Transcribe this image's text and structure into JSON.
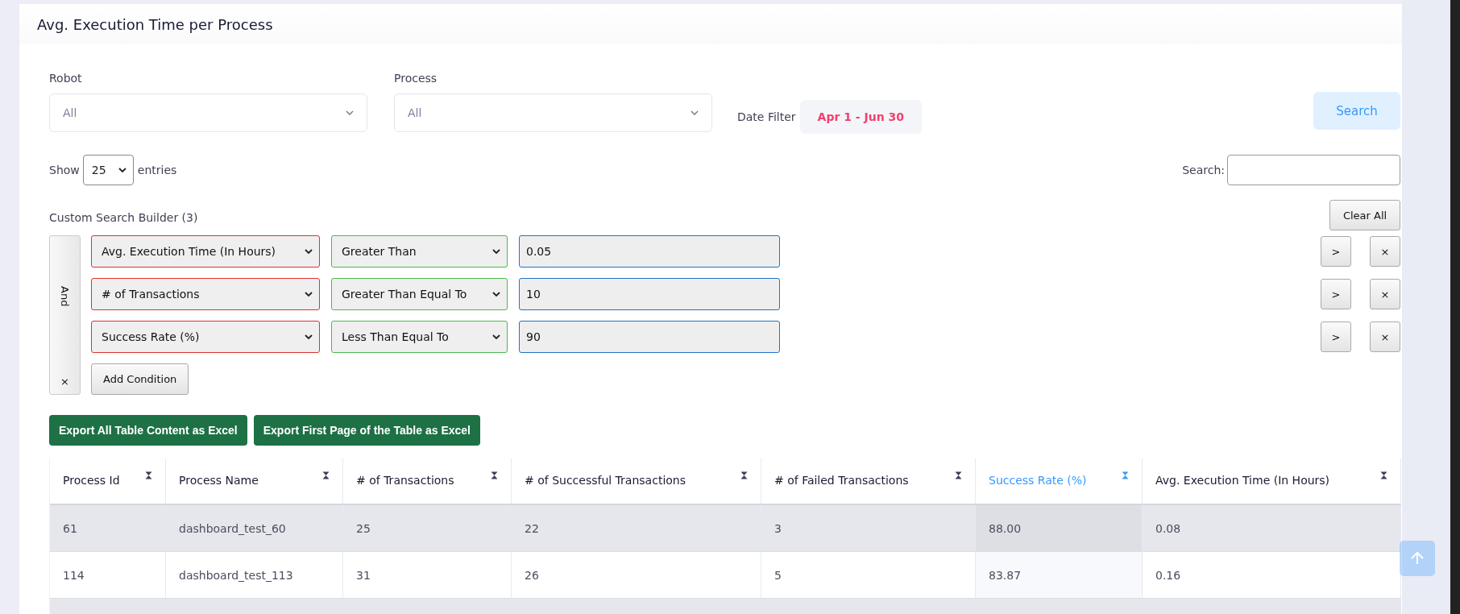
{
  "title": "Avg. Execution Time per Process",
  "filters": [
    {
      "label": "Robot",
      "value": "All"
    },
    {
      "label": "Process",
      "value": "All"
    }
  ],
  "date_filter": {
    "label": "Date Filter",
    "value": "Apr 1 - Jun 30"
  },
  "search_button": "Search",
  "length": {
    "prefix": "Show",
    "value": "25",
    "suffix": "entries"
  },
  "search": {
    "label": "Search:"
  },
  "builder": {
    "title": "Custom Search Builder (3)",
    "clear_all": "Clear All",
    "logic": "And",
    "logic_remove": "×",
    "add_condition": "Add Condition",
    "conditions": [
      {
        "field": "Avg. Execution Time (In Hours)",
        "operator": "Greater Than",
        "value": "0.05",
        "indent": ">",
        "remove": "×"
      },
      {
        "field": "# of Transactions",
        "operator": "Greater Than Equal To",
        "value": "10",
        "indent": ">",
        "remove": "×"
      },
      {
        "field": "Success Rate (%)",
        "operator": "Less Than Equal To",
        "value": "90",
        "indent": ">",
        "remove": "×"
      }
    ]
  },
  "export_buttons": [
    "Export All Table Content as Excel",
    "Export First Page of the Table as Excel"
  ],
  "table": {
    "columns": [
      {
        "label": "Process Id",
        "sorted": false
      },
      {
        "label": "Process Name",
        "sorted": false
      },
      {
        "label": "# of Transactions",
        "sorted": false
      },
      {
        "label": "# of Successful Transactions",
        "sorted": false
      },
      {
        "label": "# of Failed Transactions",
        "sorted": false
      },
      {
        "label": "Success Rate (%)",
        "sorted": true
      },
      {
        "label": "Avg. Execution Time (In Hours)",
        "sorted": false
      }
    ],
    "rows": [
      [
        "61",
        "dashboard_test_60",
        "25",
        "22",
        "3",
        "88.00",
        "0.08"
      ],
      [
        "114",
        "dashboard_test_113",
        "31",
        "26",
        "5",
        "83.87",
        "0.16"
      ]
    ]
  }
}
